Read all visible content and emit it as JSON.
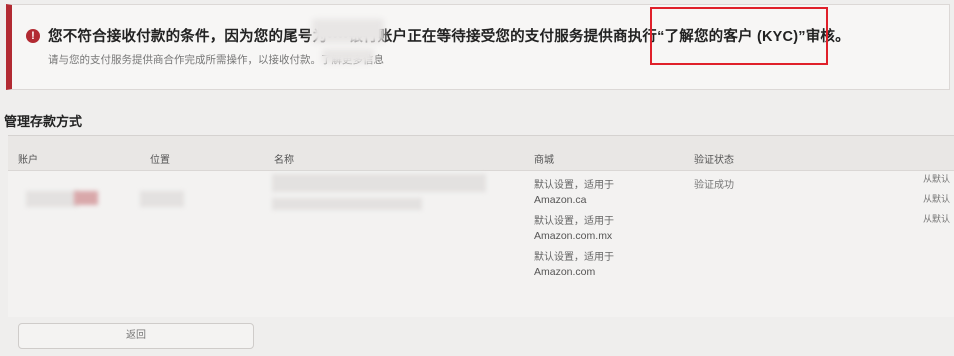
{
  "alert": {
    "icon": "exclamation-icon",
    "title": "您不符合接收付款的条件，因为您的尾号为••••银行账户正在等待接受您的支付服务提供商执行“了解您的客户 (KYC)”审核。",
    "description": "请与您的支付服务提供商合作完成所需操作，以接收付款。了解更多信息",
    "accent_color": "#b22a32",
    "highlight_color": "#e0202a"
  },
  "section": {
    "title": "管理存款方式"
  },
  "table": {
    "headers": {
      "account": "账户",
      "location": "位置",
      "name": "名称",
      "marketplace": "商城",
      "verification": "验证状态"
    },
    "row": {
      "marketplaces": [
        {
          "label": "默认设置，适用于",
          "site": "Amazon.ca"
        },
        {
          "label": "默认设置，适用于",
          "site": "Amazon.com.mx"
        },
        {
          "label": "默认设置，适用于",
          "site": "Amazon.com"
        }
      ],
      "verification_status": "验证成功",
      "default_from": [
        "从默认",
        "从默认",
        "从默认"
      ]
    }
  },
  "actions": {
    "back_label": "返回"
  }
}
